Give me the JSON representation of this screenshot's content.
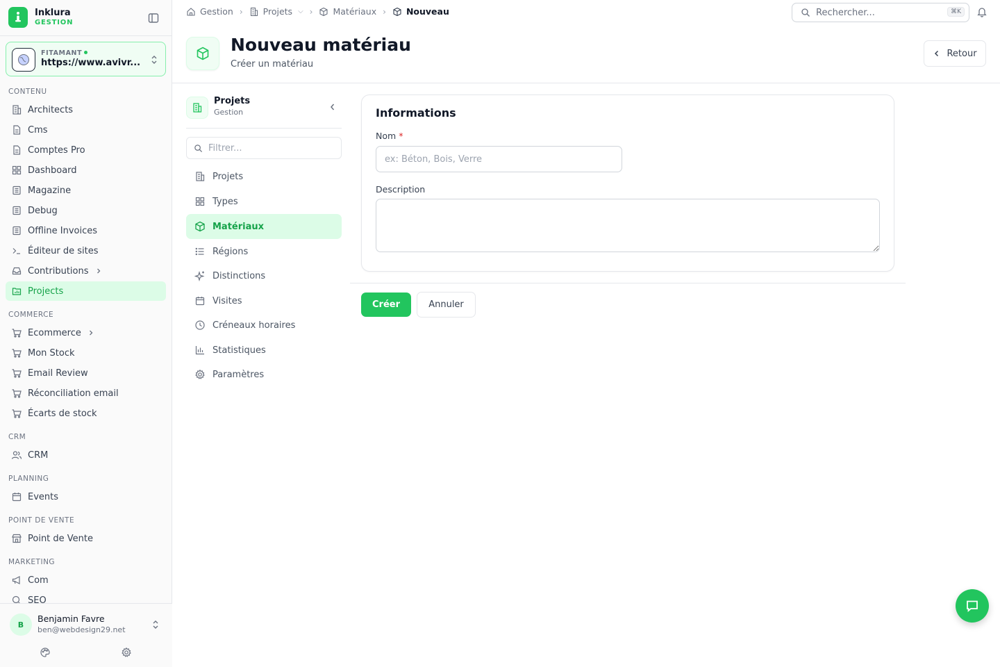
{
  "brand": {
    "name": "Inklura",
    "subtitle": "GESTION"
  },
  "site": {
    "label": "FITAMANT",
    "url": "https://www.avivr..."
  },
  "sidebar": {
    "sections": [
      {
        "title": "CONTENU",
        "items": [
          {
            "label": "Architects",
            "icon": "building-icon"
          },
          {
            "label": "Cms",
            "icon": "file-icon"
          },
          {
            "label": "Comptes Pro",
            "icon": "file-icon"
          },
          {
            "label": "Dashboard",
            "icon": "grid-icon"
          },
          {
            "label": "Magazine",
            "icon": "newspaper-icon"
          },
          {
            "label": "Debug",
            "icon": "newspaper-icon"
          },
          {
            "label": "Offline Invoices",
            "icon": "newspaper-icon"
          },
          {
            "label": "Éditeur de sites",
            "icon": "terminal-icon"
          },
          {
            "label": "Contributions",
            "icon": "inbox-icon",
            "chevron": true
          },
          {
            "label": "Projects",
            "icon": "chart-icon",
            "active": true
          }
        ]
      },
      {
        "title": "COMMERCE",
        "items": [
          {
            "label": "Ecommerce",
            "icon": "cart-icon",
            "chevron": true
          },
          {
            "label": "Mon Stock",
            "icon": "cart-icon"
          },
          {
            "label": "Email Review",
            "icon": "cart-icon"
          },
          {
            "label": "Réconciliation email",
            "icon": "cart-icon"
          },
          {
            "label": "Écarts de stock",
            "icon": "cart-icon"
          }
        ]
      },
      {
        "title": "CRM",
        "items": [
          {
            "label": "CRM",
            "icon": "users-icon"
          }
        ]
      },
      {
        "title": "PLANNING",
        "items": [
          {
            "label": "Events",
            "icon": "calendar-icon"
          }
        ]
      },
      {
        "title": "POINT DE VENTE",
        "items": [
          {
            "label": "Point de Vente",
            "icon": "store-icon"
          }
        ]
      },
      {
        "title": "MARKETING",
        "items": [
          {
            "label": "Com",
            "icon": "megaphone-icon"
          },
          {
            "label": "SEO",
            "icon": "search-icon"
          }
        ]
      }
    ]
  },
  "user": {
    "initial": "B",
    "name": "Benjamin Favre",
    "email": "ben@webdesign29.net"
  },
  "breadcrumb": {
    "items": [
      "Gestion",
      "Projets",
      "Matériaux"
    ],
    "current": "Nouveau"
  },
  "search": {
    "placeholder": "Rechercher...",
    "shortcut": "⌘K"
  },
  "header": {
    "title": "Nouveau matériau",
    "subtitle": "Créer un matériau",
    "back_label": "Retour"
  },
  "subnav": {
    "title": "Projets",
    "subtitle": "Gestion",
    "filter_placeholder": "Filtrer...",
    "items": [
      {
        "label": "Projets",
        "icon": "building-icon"
      },
      {
        "label": "Types",
        "icon": "grid-icon"
      },
      {
        "label": "Matériaux",
        "icon": "box-icon",
        "active": true
      },
      {
        "label": "Régions",
        "icon": "list-icon"
      },
      {
        "label": "Distinctions",
        "icon": "sparkle-icon"
      },
      {
        "label": "Visites",
        "icon": "calendar-icon"
      },
      {
        "label": "Créneaux horaires",
        "icon": "clock-icon"
      },
      {
        "label": "Statistiques",
        "icon": "bar-chart-icon"
      },
      {
        "label": "Paramètres",
        "icon": "gear-icon"
      }
    ]
  },
  "form": {
    "card_title": "Informations",
    "name_label": "Nom",
    "required_mark": "*",
    "name_placeholder": "ex: Béton, Bois, Verre",
    "name_value": "",
    "description_label": "Description",
    "description_value": "",
    "submit_label": "Créer",
    "cancel_label": "Annuler"
  },
  "colors": {
    "accent": "#22c55e",
    "accent_dark": "#16a34a",
    "active_bg": "#dcfce7"
  }
}
